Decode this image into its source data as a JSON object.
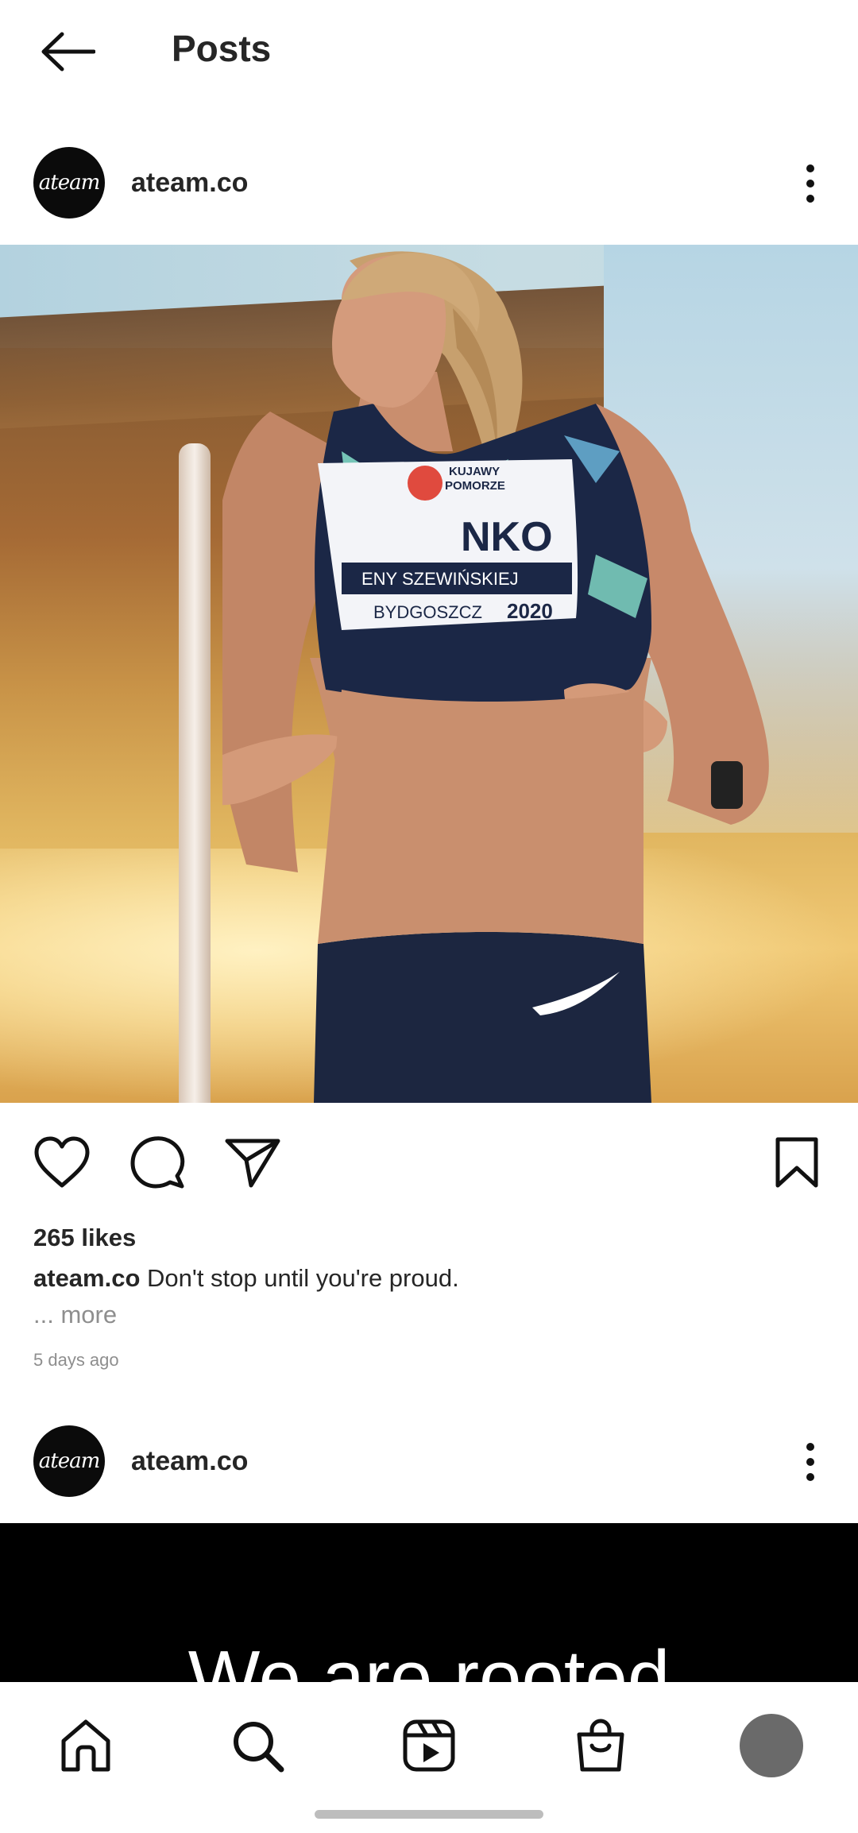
{
  "header": {
    "title": "Posts",
    "back_icon": "arrow-left-icon"
  },
  "posts": [
    {
      "username": "ateam.co",
      "avatar_text": "ateam",
      "image_description_alt": "",
      "likes": "265 likes",
      "caption_user": "ateam.co",
      "caption_text": "Don't stop until you're proud.",
      "more_label": "... more",
      "time_ago": "5 days ago",
      "bib": {
        "line1": "KUJAWY",
        "line2": "POMORZE",
        "name_partial": "NKO",
        "event": "ENY SZEWIŃSKIEJ",
        "city": "BYDGOSZCZ",
        "year": "2020"
      }
    },
    {
      "username": "ateam.co",
      "avatar_text": "ateam",
      "image_text": "We are rooted"
    }
  ],
  "actions": {
    "like_icon": "heart-icon",
    "comment_icon": "comment-bubble-icon",
    "share_icon": "paper-plane-icon",
    "save_icon": "bookmark-icon"
  },
  "bottom_nav": {
    "items": [
      "home-icon",
      "search-icon",
      "reels-icon",
      "shop-icon",
      "profile-avatar"
    ]
  },
  "colors": {
    "text_primary": "#262626",
    "text_secondary": "#8e8e8e",
    "background": "#ffffff"
  }
}
